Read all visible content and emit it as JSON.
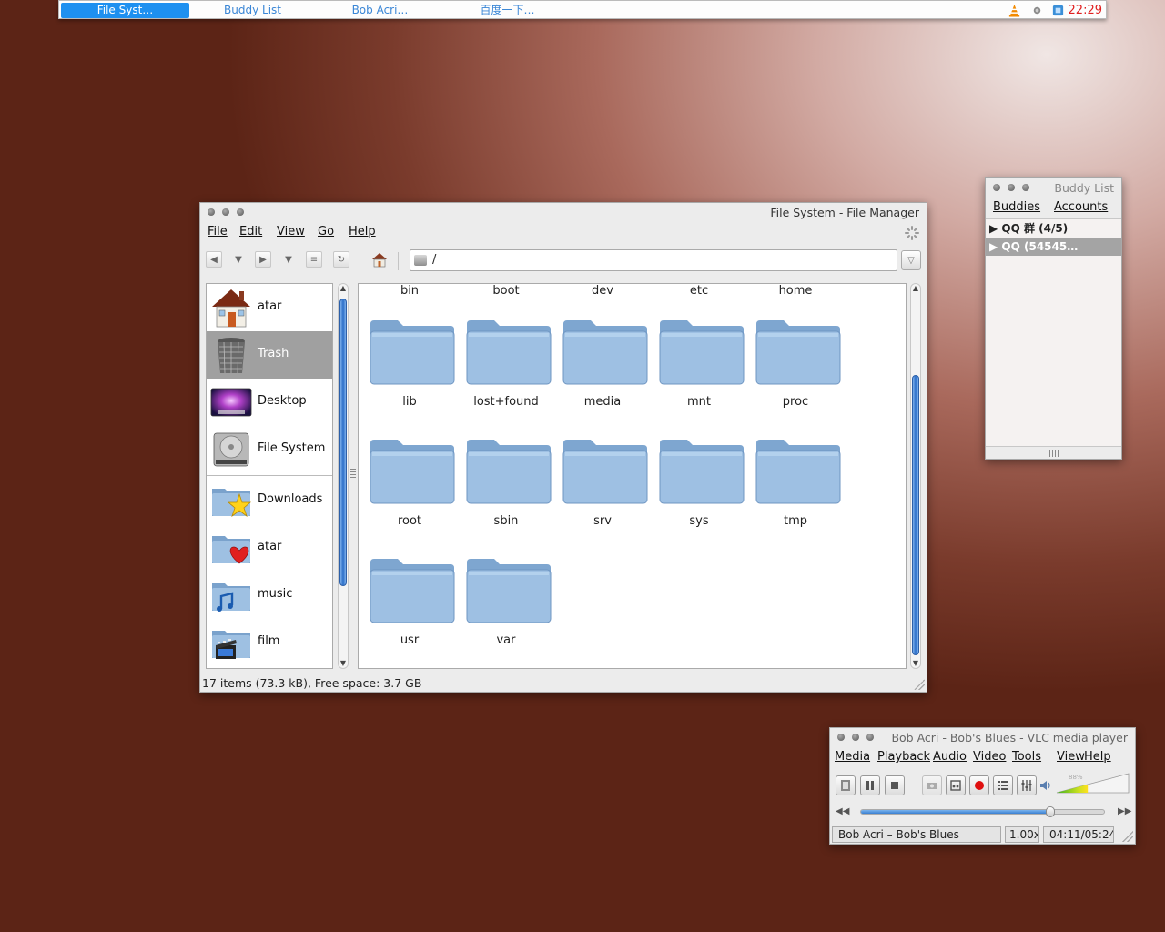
{
  "taskbar": {
    "tasks": [
      {
        "label": "File Syst…",
        "active": true
      },
      {
        "label": "Buddy List",
        "active": false
      },
      {
        "label": "Bob Acri…",
        "active": false
      },
      {
        "label": "百度一下…",
        "active": false
      }
    ],
    "tray_icons": [
      "vlc-cone-icon",
      "network-icon",
      "im-icon"
    ],
    "clock": "22:29"
  },
  "file_manager": {
    "title": "File System - File Manager",
    "menu": [
      "File",
      "Edit",
      "View",
      "Go",
      "Help"
    ],
    "path": "/",
    "sidebar": {
      "places": [
        {
          "label": "atar",
          "icon": "home-icon",
          "selected": false
        },
        {
          "label": "Trash",
          "icon": "trash-icon",
          "selected": true
        },
        {
          "label": "Desktop",
          "icon": "desktop-icon",
          "selected": false
        },
        {
          "label": "File System",
          "icon": "harddrive-icon",
          "selected": false
        }
      ],
      "bookmarks": [
        {
          "label": "Downloads",
          "icon": "star-folder-icon"
        },
        {
          "label": "atar",
          "icon": "heart-folder-icon"
        },
        {
          "label": "music",
          "icon": "music-folder-icon"
        },
        {
          "label": "film",
          "icon": "film-folder-icon"
        }
      ]
    },
    "top_row": [
      "bin",
      "boot",
      "dev",
      "etc",
      "home"
    ],
    "folders": [
      "lib",
      "lost+found",
      "media",
      "mnt",
      "proc",
      "root",
      "sbin",
      "srv",
      "sys",
      "tmp",
      "usr",
      "var"
    ],
    "status": "17 items (73.3 kB), Free space: 3.7 GB"
  },
  "buddy_list": {
    "title": "Buddy List",
    "menu": [
      "Buddies",
      "Accounts"
    ],
    "groups": [
      {
        "label": "▶ QQ 群 (4/5)",
        "selected": false
      },
      {
        "label": "▶ QQ (54545…",
        "selected": true
      }
    ]
  },
  "vlc": {
    "title": "Bob Acri - Bob's Blues - VLC media player",
    "menu": [
      "Media",
      "Playback",
      "Audio",
      "Video",
      "Tools",
      "View",
      "Help"
    ],
    "volume_pct": "88%",
    "volume_level": 0.88,
    "seek_position": 0.78,
    "now_playing": "Bob Acri – Bob's Blues",
    "speed": "1.00x",
    "time": "04:11/05:24"
  },
  "colors": {
    "accent_blue": "#1e90f0",
    "clock_red": "#e02020",
    "folder_blue": "#8fb4dc"
  }
}
